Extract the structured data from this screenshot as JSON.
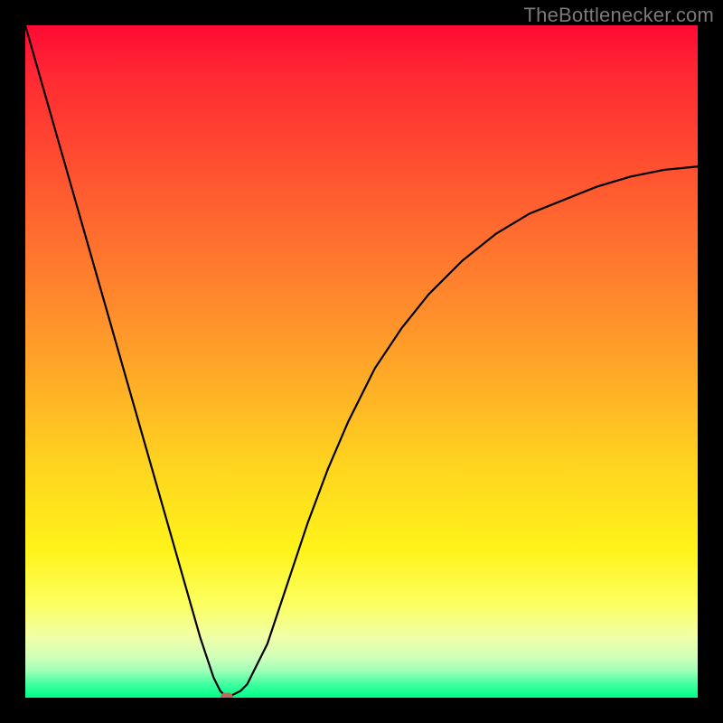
{
  "watermark": "TheBottlenecker.com",
  "chart_data": {
    "type": "line",
    "title": "",
    "xlabel": "",
    "ylabel": "",
    "xlim": [
      0,
      100
    ],
    "ylim": [
      0,
      100
    ],
    "x": [
      0,
      2,
      4,
      6,
      8,
      10,
      12,
      14,
      16,
      18,
      20,
      22,
      24,
      26,
      28,
      29,
      30,
      31,
      32,
      33,
      34,
      36,
      38,
      40,
      42,
      45,
      48,
      52,
      56,
      60,
      65,
      70,
      75,
      80,
      85,
      90,
      95,
      100
    ],
    "y": [
      100,
      93,
      86,
      79,
      72,
      65,
      58,
      51,
      44,
      37,
      30,
      23,
      16,
      9,
      3,
      1,
      0,
      0.5,
      1,
      2,
      4,
      8,
      14,
      20,
      26,
      34,
      41,
      49,
      55,
      60,
      65,
      69,
      72,
      74,
      76,
      77.5,
      78.5,
      79
    ],
    "marker": {
      "x": 30,
      "y": 0
    },
    "gradient_colors": {
      "top": "#ff0a34",
      "mid": "#ffd61f",
      "bottom": "#00ff87"
    }
  }
}
